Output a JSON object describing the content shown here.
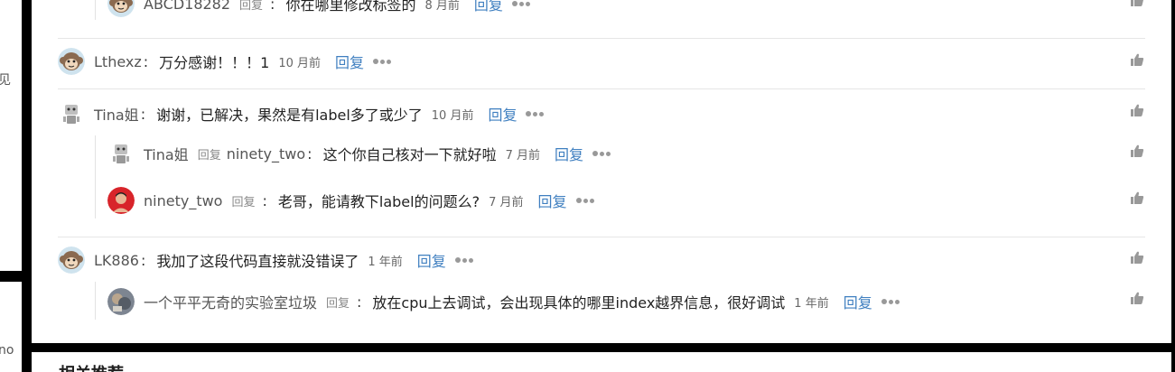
{
  "left_fragments": {
    "top": "见",
    "bottom": "no"
  },
  "comments": [
    {
      "name": "ABCD18282",
      "reply_word": "回复",
      "target": "",
      "content": "你在哪里修改标签的",
      "time": "8 月前",
      "reply": "回复",
      "avatar_icon": "monkey-avatar"
    },
    {
      "name": "Lthexz",
      "content": "万分感谢！！！1",
      "time": "10 月前",
      "reply": "回复",
      "avatar_icon": "monkey-avatar"
    },
    {
      "name": "Tina姐",
      "content": "谢谢，已解决，果然是有label多了或少了",
      "time": "10 月前",
      "reply": "回复",
      "avatar_icon": "robot-avatar"
    },
    {
      "name": "Tina姐",
      "reply_word": "回复",
      "target": "ninety_two",
      "content": "这个你自己核对一下就好啦",
      "time": "7 月前",
      "reply": "回复",
      "avatar_icon": "robot-avatar"
    },
    {
      "name": "ninety_two",
      "reply_word": "回复",
      "target": "",
      "content": "老哥，能请教下label的问题么?",
      "time": "7 月前",
      "reply": "回复",
      "avatar_icon": "red-person-avatar"
    },
    {
      "name": "LK886",
      "content": "我加了这段代码直接就没错误了",
      "time": "1 年前",
      "reply": "回复",
      "avatar_icon": "monkey-avatar"
    },
    {
      "name": "一个平平无奇的实验室垃圾",
      "reply_word": "回复",
      "target": "",
      "content": "放在cpu上去调试，会出现具体的哪里index越界信息，很好调试",
      "time": "1 年前",
      "reply": "回复",
      "avatar_icon": "photo-avatar"
    }
  ],
  "bottom_card": {
    "title": "相关推荐"
  }
}
